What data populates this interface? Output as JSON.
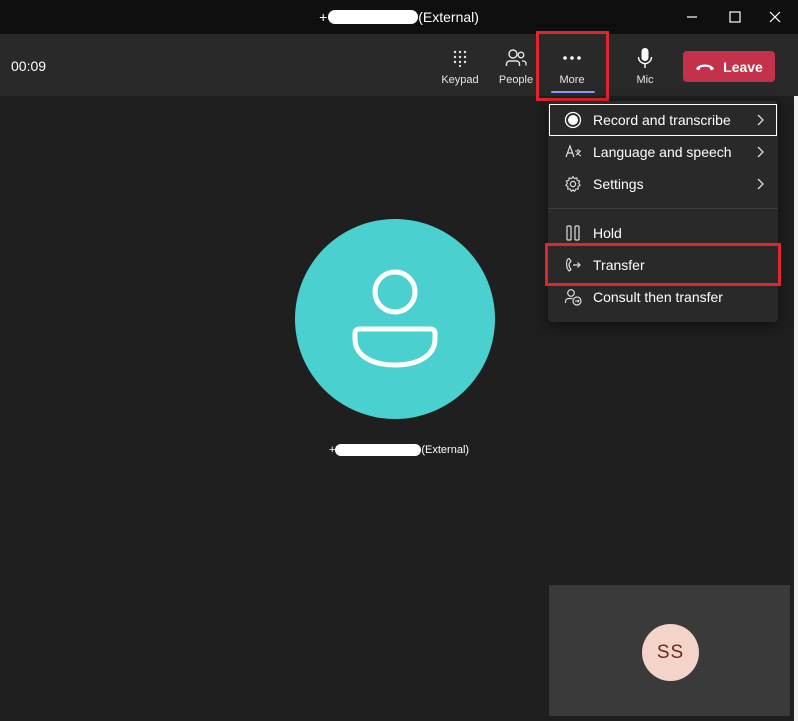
{
  "window": {
    "title_prefix": "+",
    "title_suffix": "(External)",
    "controls": [
      "minimize-icon",
      "maximize-icon",
      "close-icon"
    ]
  },
  "callbar": {
    "timer": "00:09",
    "keypad_label": "Keypad",
    "people_label": "People",
    "more_label": "More",
    "mic_label": "Mic",
    "leave_label": "Leave"
  },
  "menu": {
    "items": [
      {
        "label": "Record and transcribe",
        "icon": "record-icon",
        "submenu": true
      },
      {
        "label": "Language and speech",
        "icon": "language-icon",
        "submenu": true
      },
      {
        "label": "Settings",
        "icon": "gear-icon",
        "submenu": true
      },
      {
        "label": "Hold",
        "icon": "pause-icon",
        "submenu": false
      },
      {
        "label": "Transfer",
        "icon": "transfer-icon",
        "submenu": false
      },
      {
        "label": "Consult then transfer",
        "icon": "consult-transfer-icon",
        "submenu": false
      }
    ]
  },
  "stage": {
    "caller_prefix": "+",
    "caller_suffix": "(External)"
  },
  "selfview": {
    "initials": "SS"
  },
  "colors": {
    "leave": "#c4314b",
    "avatar": "#4ad1cf",
    "highlight": "#e0262d",
    "accent_underline": "#8f96ff",
    "self_avatar": "#f4d3c8"
  }
}
